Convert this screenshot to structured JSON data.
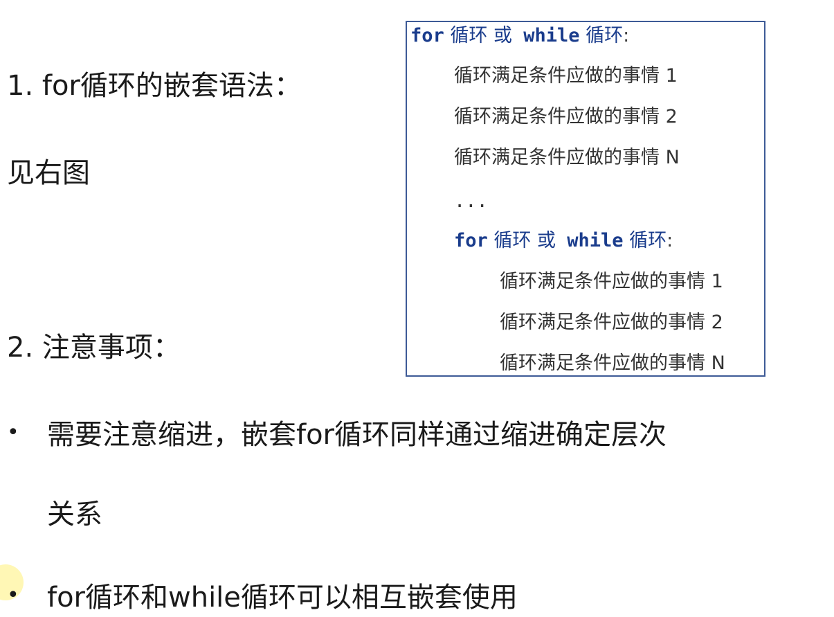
{
  "section1": {
    "title": "1. for循环的嵌套语法：",
    "subtitle": "见右图"
  },
  "section2": {
    "title": "2. 注意事项："
  },
  "bullets": [
    {
      "dot": "•",
      "text": "需要注意缩进，嵌套for循环同样通过缩进确定层次",
      "continuation": "关系"
    },
    {
      "dot": "•",
      "text": "for循环和while循环可以相互嵌套使用"
    }
  ],
  "code": {
    "outer_header": {
      "kw_for": "for",
      "text_loop1": " 循环 ",
      "text_or": "或",
      "kw_while": " while",
      "text_loop2": " 循环",
      "colon": ":"
    },
    "outer_lines": [
      "循环满足条件应做的事情 1",
      "循环满足条件应做的事情 2",
      "循环满足条件应做的事情 N",
      "..."
    ],
    "inner_header": {
      "kw_for": "for",
      "text_loop1": " 循环 ",
      "text_or": "或",
      "kw_while": " while",
      "text_loop2": " 循环",
      "colon": ":"
    },
    "inner_lines": [
      "循环满足条件应做的事情 1",
      "循环满足条件应做的事情 2",
      "循环满足条件应做的事情 N"
    ]
  },
  "colors": {
    "keyword": "#1a3c8c",
    "box_border": "#3d5a96",
    "text": "#1a1a1a"
  }
}
